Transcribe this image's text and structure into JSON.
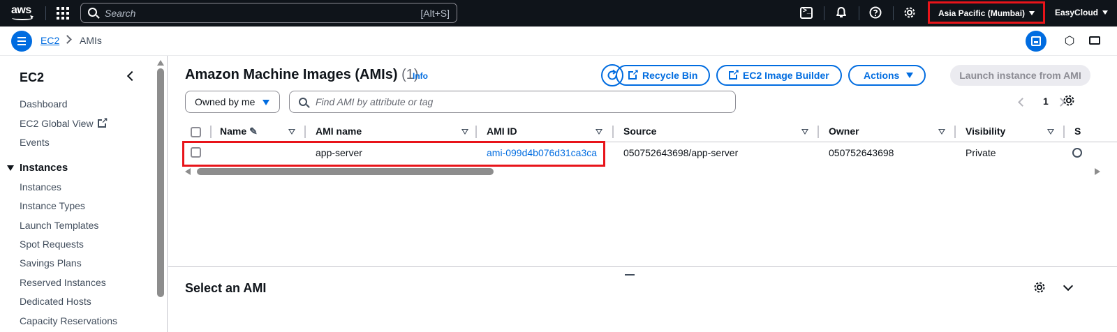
{
  "topbar": {
    "logo": "aws",
    "search_placeholder": "Search",
    "search_shortcut": "[Alt+S]",
    "region": "Asia Pacific (Mumbai)",
    "account": "EasyCloud",
    "icons": [
      "grid-icon",
      "search-icon",
      "cloudshell-icon",
      "bell-icon",
      "help-icon",
      "gear-icon"
    ]
  },
  "breadcrumb": {
    "items": [
      "EC2",
      "AMIs"
    ]
  },
  "sidebar": {
    "title": "EC2",
    "links": [
      "Dashboard",
      "EC2 Global View",
      "Events"
    ],
    "section": "Instances",
    "section_items": [
      "Instances",
      "Instance Types",
      "Launch Templates",
      "Spot Requests",
      "Savings Plans",
      "Reserved Instances",
      "Dedicated Hosts",
      "Capacity Reservations"
    ]
  },
  "main": {
    "title": "Amazon Machine Images (AMIs)",
    "count": "(1)",
    "info": "Info",
    "buttons": {
      "recycle_bin": "Recycle Bin",
      "image_builder": "EC2 Image Builder",
      "actions": "Actions",
      "launch": "Launch instance from AMI"
    },
    "filter_select": "Owned by me",
    "filter_placeholder": "Find AMI by attribute or tag",
    "page": "1",
    "columns": [
      "Name",
      "AMI name",
      "AMI ID",
      "Source",
      "Owner",
      "Visibility",
      "S"
    ],
    "rows": [
      {
        "name": "",
        "ami_name": "app-server",
        "ami_id": "ami-099d4b076d31ca3ca",
        "source": "050752643698/app-server",
        "owner": "050752643698",
        "visibility": "Private"
      }
    ],
    "split_title": "Select an AMI"
  },
  "colors": {
    "accent": "#006ce0",
    "topbar": "#0f141a",
    "highlight": "#e8141a"
  }
}
